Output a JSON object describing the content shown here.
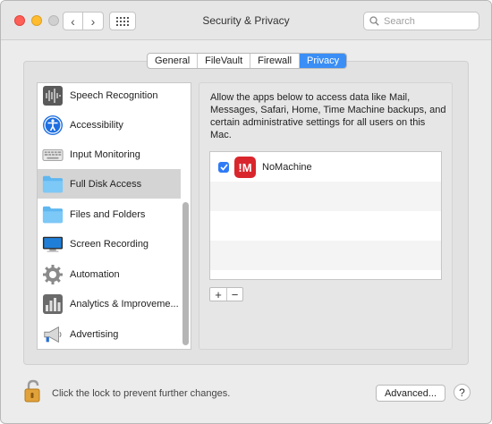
{
  "window": {
    "title": "Security & Privacy",
    "nav_back": "‹",
    "nav_forward": "›",
    "search_placeholder": "Search"
  },
  "tabs": [
    {
      "label": "General",
      "active": false
    },
    {
      "label": "FileVault",
      "active": false
    },
    {
      "label": "Firewall",
      "active": false
    },
    {
      "label": "Privacy",
      "active": true
    }
  ],
  "privacy_list": {
    "items": [
      {
        "label": "Speech Recognition",
        "icon": "speech-recognition-icon"
      },
      {
        "label": "Accessibility",
        "icon": "accessibility-icon"
      },
      {
        "label": "Input Monitoring",
        "icon": "keyboard-icon"
      },
      {
        "label": "Full Disk Access",
        "icon": "folder-icon",
        "selected": true
      },
      {
        "label": "Files and Folders",
        "icon": "folder-icon"
      },
      {
        "label": "Screen Recording",
        "icon": "display-icon"
      },
      {
        "label": "Automation",
        "icon": "gear-icon"
      },
      {
        "label": "Analytics & Improveme...",
        "icon": "analytics-icon"
      },
      {
        "label": "Advertising",
        "icon": "megaphone-icon"
      }
    ]
  },
  "detail": {
    "description": "Allow the apps below to access data like Mail, Messages, Safari, Home, Time Machine backups, and certain administrative settings for all users on this Mac.",
    "apps": [
      {
        "name": "NoMachine",
        "checked": true,
        "icon_text": "!M"
      }
    ],
    "add_label": "+",
    "remove_label": "−"
  },
  "footer": {
    "lock_text": "Click the lock to prevent further changes.",
    "advanced_label": "Advanced...",
    "help_label": "?"
  },
  "colors": {
    "accent": "#3a8ef6",
    "nomachine": "#d9262c"
  }
}
